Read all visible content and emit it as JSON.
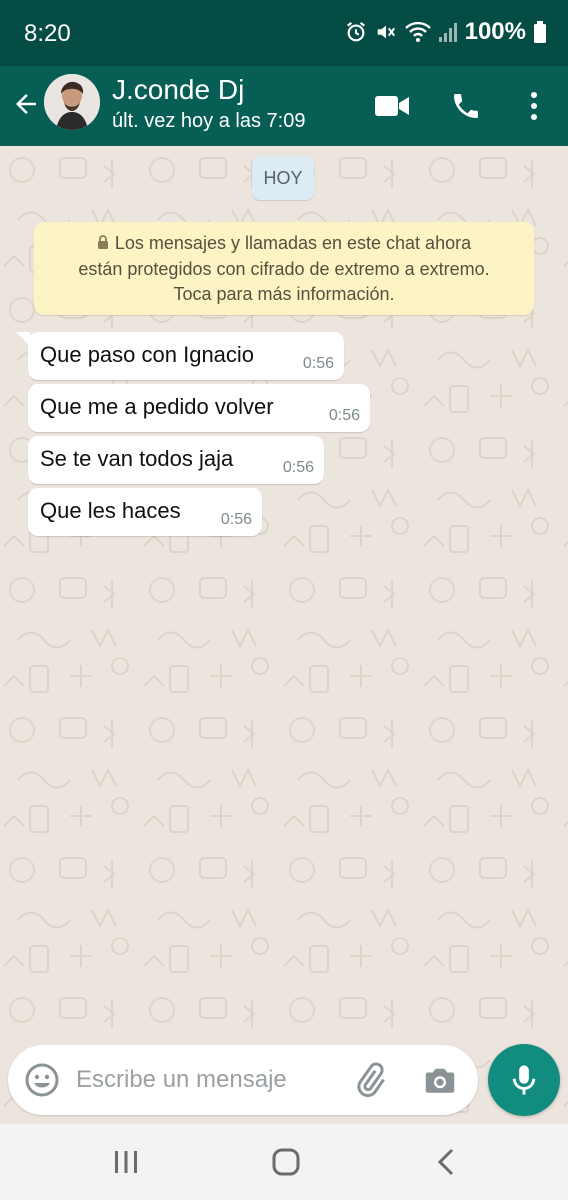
{
  "status_bar": {
    "time": "8:20",
    "battery": "100%",
    "icons": [
      "alarm-icon",
      "mute-icon",
      "wifi-icon",
      "signal-icon",
      "battery-icon"
    ]
  },
  "header": {
    "contact_name": "J.conde Dj",
    "last_seen": "últ. vez hoy a las 7:09",
    "icons": [
      "back-arrow-icon",
      "video-call-icon",
      "phone-icon",
      "more-vert-icon"
    ]
  },
  "chat": {
    "date_chip": "HOY",
    "encryption_notice": {
      "line1": "Los mensajes y llamadas en este chat ahora",
      "line2": "están protegidos con cifrado de extremo a extremo.",
      "line3": "Toca para más información."
    },
    "messages": [
      {
        "text": "Que paso con Ignacio",
        "time": "0:56"
      },
      {
        "text": "Que me a pedido volver",
        "time": "0:56"
      },
      {
        "text": "Se te van todos jaja",
        "time": "0:56"
      },
      {
        "text": "Que les haces",
        "time": "0:56"
      }
    ]
  },
  "composer": {
    "placeholder": "Escribe un mensaje",
    "value": "",
    "icons": [
      "emoji-icon",
      "attach-icon",
      "camera-icon",
      "mic-icon"
    ]
  },
  "nav_bar": {
    "icons": [
      "recents-icon",
      "home-icon",
      "back-icon"
    ]
  },
  "colors": {
    "status_bar": "#054d44",
    "app_bar": "#075e54",
    "chat_bg": "#ece5dd",
    "mic_button": "#128c7e",
    "notice_bg": "#fdf4c5",
    "date_chip_bg": "#dcebf4"
  }
}
